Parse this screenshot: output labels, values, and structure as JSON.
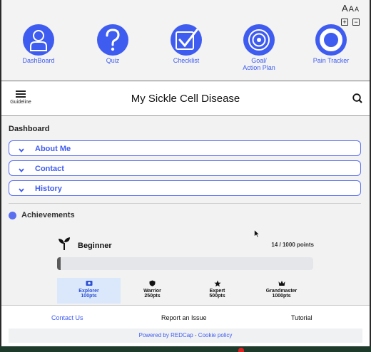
{
  "font_controls": {
    "label": "AAA",
    "plus": "+",
    "minus": "−"
  },
  "nav": [
    {
      "label": "DashBoard",
      "icon": "user-icon"
    },
    {
      "label": "Quiz",
      "icon": "question-icon"
    },
    {
      "label": "Checklist",
      "icon": "check-icon"
    },
    {
      "label": "Goal/\nAction Plan",
      "icon": "target-icon"
    },
    {
      "label": "Pain Tracker",
      "icon": "ring-icon"
    }
  ],
  "header": {
    "menu_label": "Guideline",
    "title": "My Sickle Cell Disease",
    "search_icon": "search-icon"
  },
  "dashboard": {
    "title": "Dashboard",
    "accordions": [
      "About Me",
      "Contact",
      "History"
    ],
    "achievements_title": "Achievements",
    "level": {
      "name": "Beginner",
      "points_text": "14 / 1000 points",
      "current": 14,
      "max": 1000
    },
    "tiers": [
      {
        "name": "Explorer",
        "pts": "100pts",
        "icon": "money-icon",
        "active": true
      },
      {
        "name": "Warrior",
        "pts": "250pts",
        "icon": "shield-icon",
        "active": false
      },
      {
        "name": "Expert",
        "pts": "500pts",
        "icon": "star-icon",
        "active": false
      },
      {
        "name": "Grandmaster",
        "pts": "1000pts",
        "icon": "crown-icon",
        "active": false
      }
    ]
  },
  "footer": {
    "contact": "Contact Us",
    "report": "Report an Issue",
    "tutorial": "Tutorial",
    "powered": "Powered by REDCap",
    "sep": "-",
    "cookie": "Cookie policy"
  },
  "colors": {
    "accent": "#3f5cf0",
    "tier_active_bg": "#dbe8fb"
  }
}
